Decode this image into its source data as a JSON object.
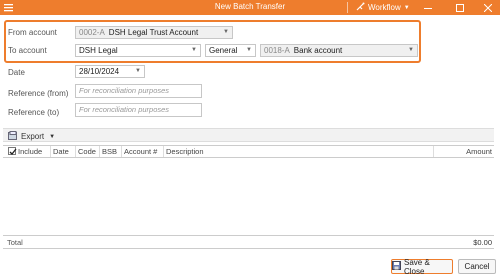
{
  "window": {
    "title": "New Batch Transfer",
    "workflow_label": "Workflow",
    "accent_color": "#ee7d2d"
  },
  "from_account": {
    "label": "From account",
    "code": "0002-A",
    "name": "DSH Legal Trust Account"
  },
  "to_account": {
    "label": "To account",
    "entity": "DSH Legal",
    "ledger": "General",
    "code": "0018-A",
    "name": "Bank account"
  },
  "date": {
    "label": "Date",
    "value": "28/10/2024"
  },
  "reference_from": {
    "label": "Reference (from)",
    "placeholder": "For reconciliation purposes"
  },
  "reference_to": {
    "label": "Reference (to)",
    "placeholder": "For reconciliation purposes"
  },
  "toolbar": {
    "export_label": "Export"
  },
  "grid": {
    "columns": [
      "Include",
      "Date",
      "Code",
      "BSB",
      "Account #",
      "Description",
      "Amount"
    ],
    "include_checked": true
  },
  "total": {
    "label": "Total",
    "amount": "$0.00"
  },
  "buttons": {
    "save_close": "Save & Close",
    "cancel": "Cancel"
  }
}
